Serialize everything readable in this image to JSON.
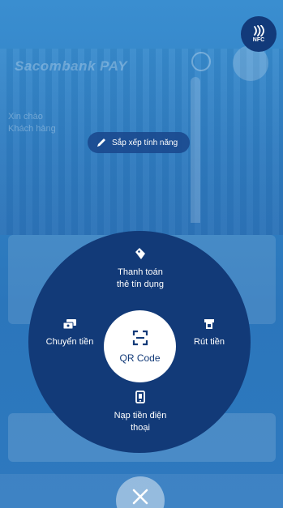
{
  "background": {
    "brand_text": "Sacombank PAY",
    "greeting_line1": "Xin chào",
    "greeting_line2": "Khách hàng"
  },
  "nfc": {
    "label": "NFC",
    "icon": "nfc-icon"
  },
  "sort_button": {
    "label": "Sắp xếp tính năng",
    "icon": "pencil-icon"
  },
  "wheel": {
    "center": {
      "label": "QR Code",
      "icon": "qr-scan-icon"
    },
    "top": {
      "line1": "Thanh toán",
      "line2": "thẻ tín dụng",
      "icon": "tag-icon"
    },
    "left": {
      "label": "Chuyển tiền",
      "icon": "money-transfer-icon"
    },
    "right": {
      "label": "Rút tiền",
      "icon": "atm-withdraw-icon"
    },
    "bottom": {
      "line1": "Nạp tiền điện",
      "line2": "thoại",
      "icon": "phone-topup-icon"
    }
  },
  "close": {
    "icon": "close-icon"
  },
  "colors": {
    "wheel": "#123a78",
    "nfc": "#123a7a",
    "overlay": "#2b76bb"
  }
}
